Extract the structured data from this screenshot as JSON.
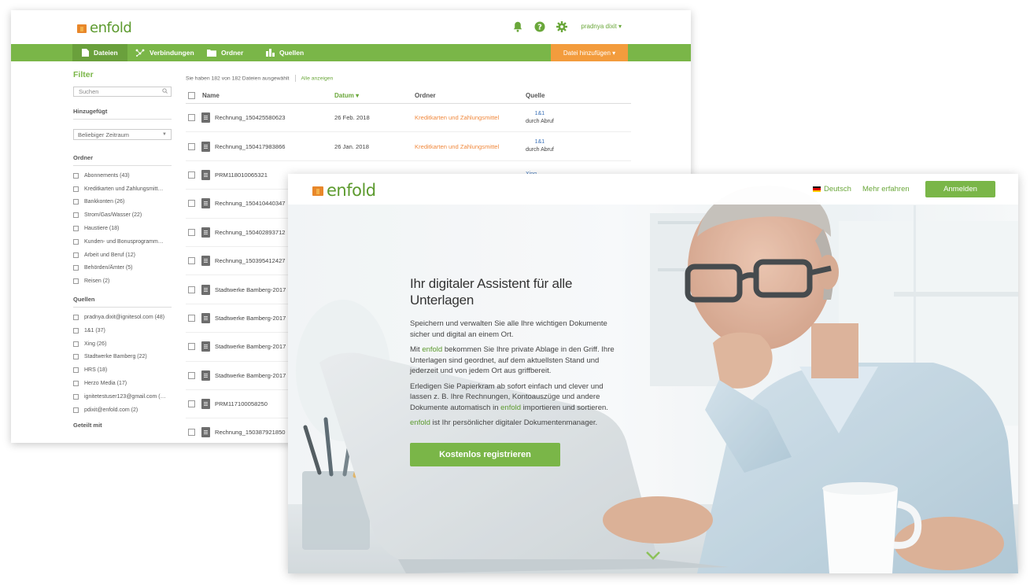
{
  "brand": {
    "logo_text": "enfold",
    "green": "#7ab648",
    "orange": "#f39c3d"
  },
  "app": {
    "header": {
      "icons": [
        "bell-icon",
        "help-icon",
        "gear-icon"
      ],
      "user": "pradnya dixit ▾"
    },
    "nav": [
      {
        "label": "Dateien",
        "icon": "file-icon"
      },
      {
        "label": "Verbindungen",
        "icon": "connections-icon"
      },
      {
        "label": "Ordner",
        "icon": "folder-icon"
      },
      {
        "label": "Quellen",
        "icon": "sources-icon"
      }
    ],
    "add_button": "Datei hinzufügen  ▾",
    "filter": {
      "title": "Filter",
      "search_placeholder": "Suchen",
      "added_label": "Hinzugefügt",
      "time_select": "Beliebiger Zeitraum",
      "folders_label": "Ordner",
      "folders": [
        "Abonnements (43)",
        "Kreditkarten und Zahlungsmitt…",
        "Bankkonten (26)",
        "Strom/Gas/Wasser (22)",
        "Haustiere (18)",
        "Kunden- und Bonusprogramm…",
        "Arbeit und Beruf (12)",
        "Behörden/Ämter (5)",
        "Reisen (2)"
      ],
      "sources_label": "Quellen",
      "sources": [
        "pradnya.dixit@ignitesol.com (48)",
        "1&1 (37)",
        "Xing (26)",
        "Stadtwerke Bamberg (22)",
        "HRS (18)",
        "Herzo Media (17)",
        "ignitetestuser123@gmail.com (…",
        "pdixit@enfold.com (2)"
      ],
      "shared_label": "Geteilt mit"
    },
    "table": {
      "info": "Sie haben 182 von 182 Dateien ausgewählt",
      "show_all": "Alle anzeigen",
      "headers": {
        "name": "Name",
        "date": "Datum ▾",
        "folder": "Ordner",
        "source": "Quelle"
      },
      "rows": [
        {
          "name": "Rechnung_150425580623",
          "date": "26 Feb. 2018",
          "folder": "Kreditkarten und Zahlungsmittel",
          "source": "1&1",
          "via": "durch Abruf"
        },
        {
          "name": "Rechnung_150417983866",
          "date": "26 Jan. 2018",
          "folder": "Kreditkarten und Zahlungsmittel",
          "source": "1&1",
          "via": "durch Abruf"
        },
        {
          "name": "PRM118010065321",
          "date": "",
          "folder": "",
          "source": "Xing",
          "via": ""
        },
        {
          "name": "Rechnung_150410440347",
          "date": "",
          "folder": "",
          "source": "",
          "via": ""
        },
        {
          "name": "Rechnung_150402893712",
          "date": "",
          "folder": "",
          "source": "",
          "via": ""
        },
        {
          "name": "Rechnung_150395412427",
          "date": "",
          "folder": "",
          "source": "",
          "via": ""
        },
        {
          "name": "Stadtwerke Bamberg-2017",
          "date": "",
          "folder": "",
          "source": "",
          "via": ""
        },
        {
          "name": "Stadtwerke Bamberg-2017",
          "date": "",
          "folder": "",
          "source": "",
          "via": ""
        },
        {
          "name": "Stadtwerke Bamberg-2017",
          "date": "",
          "folder": "",
          "source": "",
          "via": ""
        },
        {
          "name": "Stadtwerke Bamberg-2017",
          "date": "",
          "folder": "",
          "source": "",
          "via": ""
        },
        {
          "name": "PRM117100058250",
          "date": "",
          "folder": "",
          "source": "",
          "via": ""
        },
        {
          "name": "Rechnung_150387921850",
          "date": "",
          "folder": "",
          "source": "",
          "via": ""
        }
      ]
    }
  },
  "landing": {
    "language": "Deutsch",
    "more": "Mehr erfahren",
    "login": "Anmelden",
    "title": "Ihr digitaler Assistent für alle Unterlagen",
    "p1": "Speichern und verwalten Sie alle Ihre wichtigen Dokumente sicher und digital an einem Ort.",
    "p2_pre": "Mit ",
    "p2_post": " bekommen Sie Ihre private Ablage in den Griff. Ihre Unterlagen sind geordnet, auf dem aktuellsten Stand und jederzeit und von jedem Ort aus griffbereit.",
    "p3_pre": "Erledigen Sie Papierkram ab sofort einfach und clever und lassen z. B. Ihre Rechnungen, Kontoauszüge und andere Dokumente automatisch in ",
    "p3_post": " importieren und sortieren.",
    "p4_post": " ist Ihr persönlicher digitaler Dokumentenmanager.",
    "register": "Kostenlos registrieren"
  }
}
